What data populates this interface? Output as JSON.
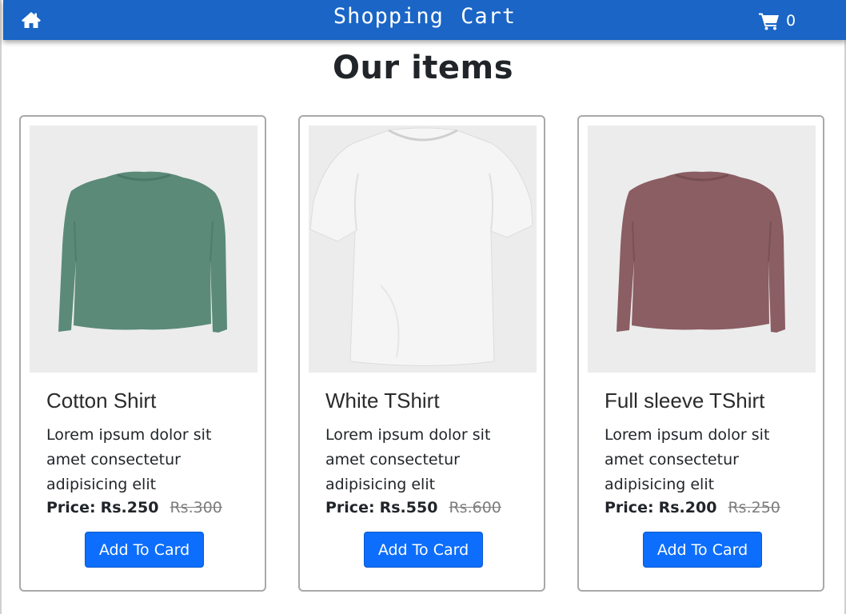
{
  "navbar": {
    "title": "Shopping Cart",
    "home_icon": "home-icon",
    "cart_icon": "shopping-cart-icon",
    "cart_count": "0",
    "background_color": "#1a65c6"
  },
  "heading": "Our items",
  "products": [
    {
      "title": "Cotton Shirt",
      "description": "Lorem ipsum dolor sit amet consectetur adipisicing elit",
      "price_label": "Price:",
      "price": "Rs.250",
      "old_price": "Rs.300",
      "button_label": "Add To Card",
      "image_color": "#5b8a78"
    },
    {
      "title": "White TShirt",
      "description": "Lorem ipsum dolor sit amet consectetur adipisicing elit",
      "price_label": "Price:",
      "price": "Rs.550",
      "old_price": "Rs.600",
      "button_label": "Add To Card",
      "image_color": "#f4f4f4"
    },
    {
      "title": "Full sleeve TShirt",
      "description": "Lorem ipsum dolor sit amet consectetur adipisicing elit",
      "price_label": "Price:",
      "price": "Rs.200",
      "old_price": "Rs.250",
      "button_label": "Add To Card",
      "image_color": "#8a5e62"
    }
  ],
  "colors": {
    "primary_button": "#0d6efd",
    "old_price": "#7d7d7d"
  }
}
